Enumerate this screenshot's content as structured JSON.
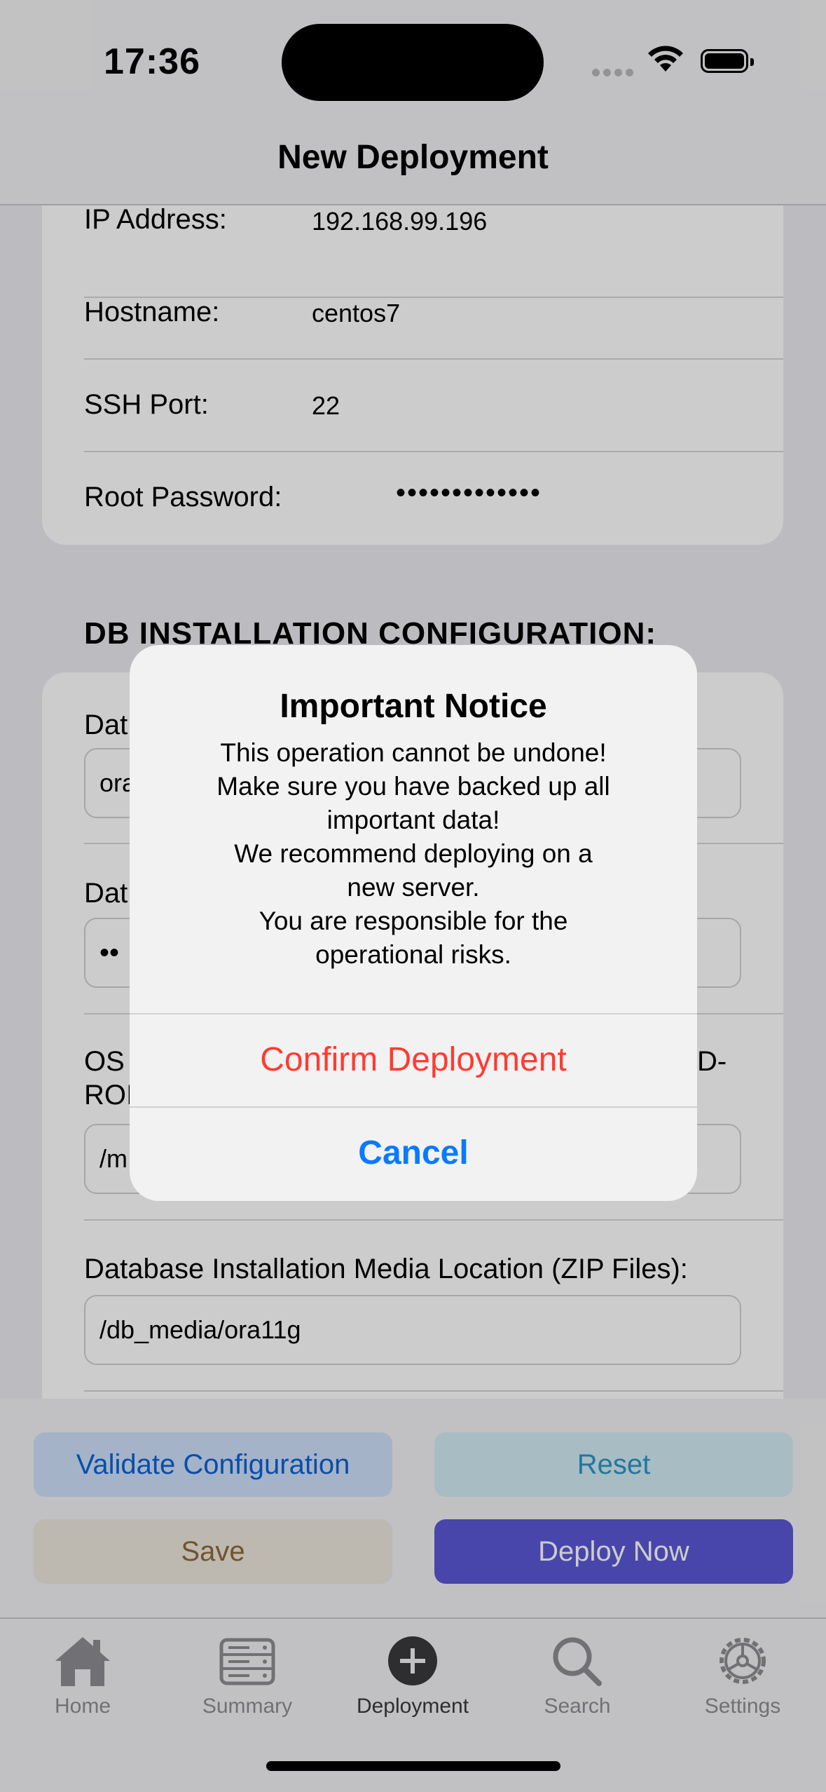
{
  "status_bar": {
    "time": "17:36"
  },
  "nav": {
    "title": "New Deployment"
  },
  "server_fields": [
    {
      "label": "IP Address:",
      "value": "192.168.99.196"
    },
    {
      "label": "Hostname:",
      "value": "centos7"
    },
    {
      "label": "SSH Port:",
      "value": "22"
    },
    {
      "label": "Root Password:",
      "value": "•••••••••••••"
    }
  ],
  "db_section": {
    "title": "DB INSTALLATION CONFIGURATION:",
    "field1_label": "Dat",
    "field1_value": "ora",
    "field2_label": "Dat",
    "field2_value": "••",
    "field3_label_line1": "OS",
    "field3_label_right": "D-",
    "field3_label_line2": "ROI",
    "field3_value": "/m",
    "media_label": "Database Installation Media Location (ZIP Files):",
    "media_value": "/db_media/ora11g"
  },
  "actions": {
    "validate": "Validate Configuration",
    "reset": "Reset",
    "save": "Save",
    "deploy": "Deploy Now"
  },
  "tabs": [
    {
      "label": "Home",
      "icon": "house-icon"
    },
    {
      "label": "Summary",
      "icon": "server-rack-icon"
    },
    {
      "label": "Deployment",
      "icon": "plus-circle-icon"
    },
    {
      "label": "Search",
      "icon": "magnifier-icon"
    },
    {
      "label": "Settings",
      "icon": "gear-icon"
    }
  ],
  "alert": {
    "title": "Important Notice",
    "message_lines": [
      "This operation cannot be undone!",
      "Make sure you have backed up all",
      "important data!",
      "We recommend deploying on a",
      "new server.",
      "You are responsible for the",
      "operational risks."
    ],
    "confirm": "Confirm Deployment",
    "cancel": "Cancel"
  },
  "colors": {
    "destructive": "#ff3b30",
    "accent": "#0a7aff",
    "deploy_button": "#5a58d6"
  }
}
